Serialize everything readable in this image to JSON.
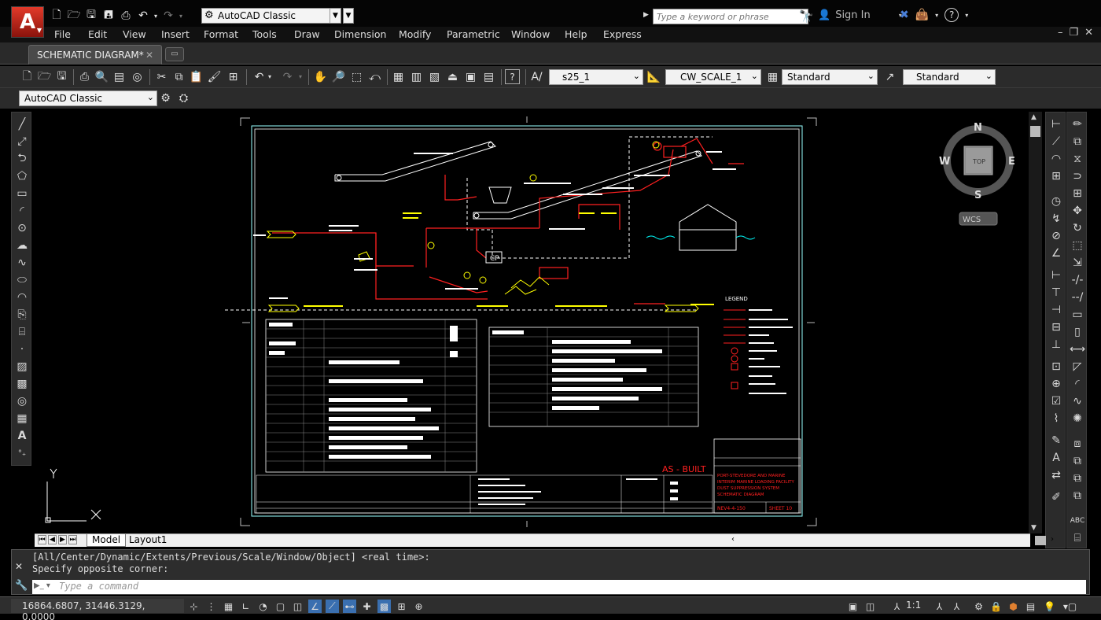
{
  "app": {
    "logo_letter": "A",
    "workspace": "AutoCAD Classic",
    "search_placeholder": "Type a keyword or phrase",
    "sign_in": "Sign In"
  },
  "menu": [
    "File",
    "Edit",
    "View",
    "Insert",
    "Format",
    "Tools",
    "Draw",
    "Dimension",
    "Modify",
    "Parametric",
    "Window",
    "Help",
    "Express"
  ],
  "tabs": {
    "document": "SCHEMATIC DIAGRAM*"
  },
  "toolbar": {
    "text_style": "s25_1",
    "dim_style": "CW_SCALE_1",
    "table_style": "Standard",
    "mleader_style": "Standard",
    "workspace2": "AutoCAD Classic"
  },
  "viewcube": {
    "north": "N",
    "south": "S",
    "east": "E",
    "west": "W",
    "top": "TOP",
    "wcs": "WCS"
  },
  "ucs": {
    "y": "Y"
  },
  "layout_tabs": {
    "model": "Model",
    "layout1": "Layout1"
  },
  "command": {
    "history_1": "[All/Center/Dynamic/Extents/Previous/Scale/Window/Object] <real time>:",
    "history_2": "Specify opposite corner:",
    "placeholder": "Type a command"
  },
  "status": {
    "coordinates": "16864.6807, 31446.3129, 0.0000",
    "annotation_scale": "1:1"
  },
  "drawing": {
    "stamp": "AS - BUILT",
    "legend_title": "LEGEND",
    "cp_label": "CP",
    "title_lines": [
      "PORT-STEVEDORE AND MARINE",
      "INTERIM MARINE LOADING FACILITY",
      "DUST SUPPRESSION SYSTEM",
      "SCHEMATIC DIAGRAM"
    ],
    "dwg_no": "NEV4-4-150",
    "sheet": "SHEET 10"
  },
  "colors": {
    "accent_red": "#e23a2a",
    "cad_yellow": "#ffff00",
    "cad_red": "#ff2020",
    "cad_cyan": "#00ffff"
  }
}
